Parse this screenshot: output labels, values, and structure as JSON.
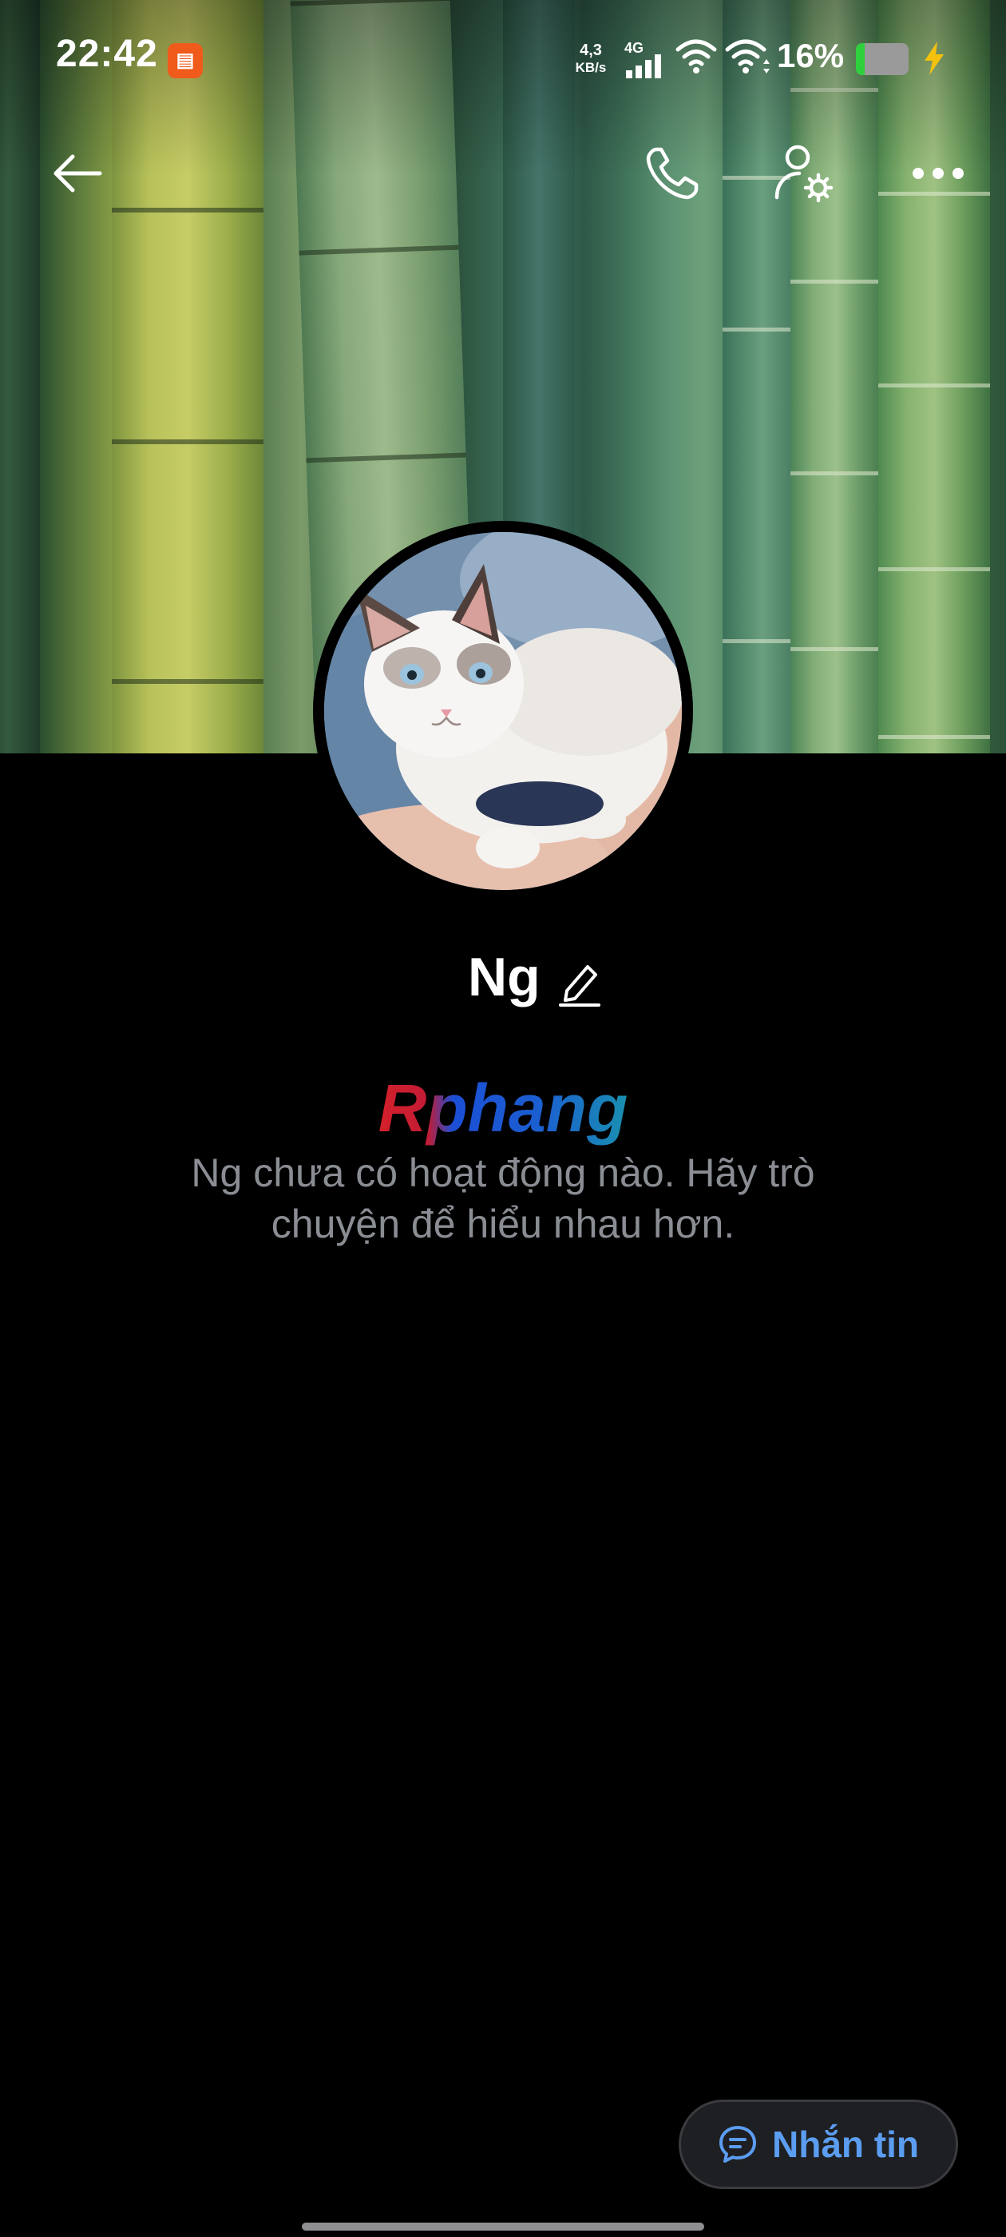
{
  "status_bar": {
    "time": "22:42",
    "net_speed_value": "4,3",
    "net_speed_unit": "KB/s",
    "network_type": "4G",
    "battery_percent": "16%",
    "battery_level": 0.16
  },
  "profile": {
    "name": "Ng",
    "empty_state": "Ng chưa có hoạt động nào. Hãy trò chuyện để hiểu nhau hơn."
  },
  "watermark": {
    "text": "Rphang",
    "colors": [
      "#d4202a",
      "#1b4fd6",
      "#1a8fb0"
    ]
  },
  "actions": {
    "back_icon": "arrow-left-icon",
    "call_icon": "phone-icon",
    "settings_icon": "user-settings-icon",
    "more_icon": "more-dots-icon",
    "message_label": "Nhắn tin",
    "message_icon": "chat-bubble-icon"
  },
  "colors": {
    "accent": "#5b9df0",
    "background": "#000000",
    "muted_text": "#8a8d93"
  }
}
